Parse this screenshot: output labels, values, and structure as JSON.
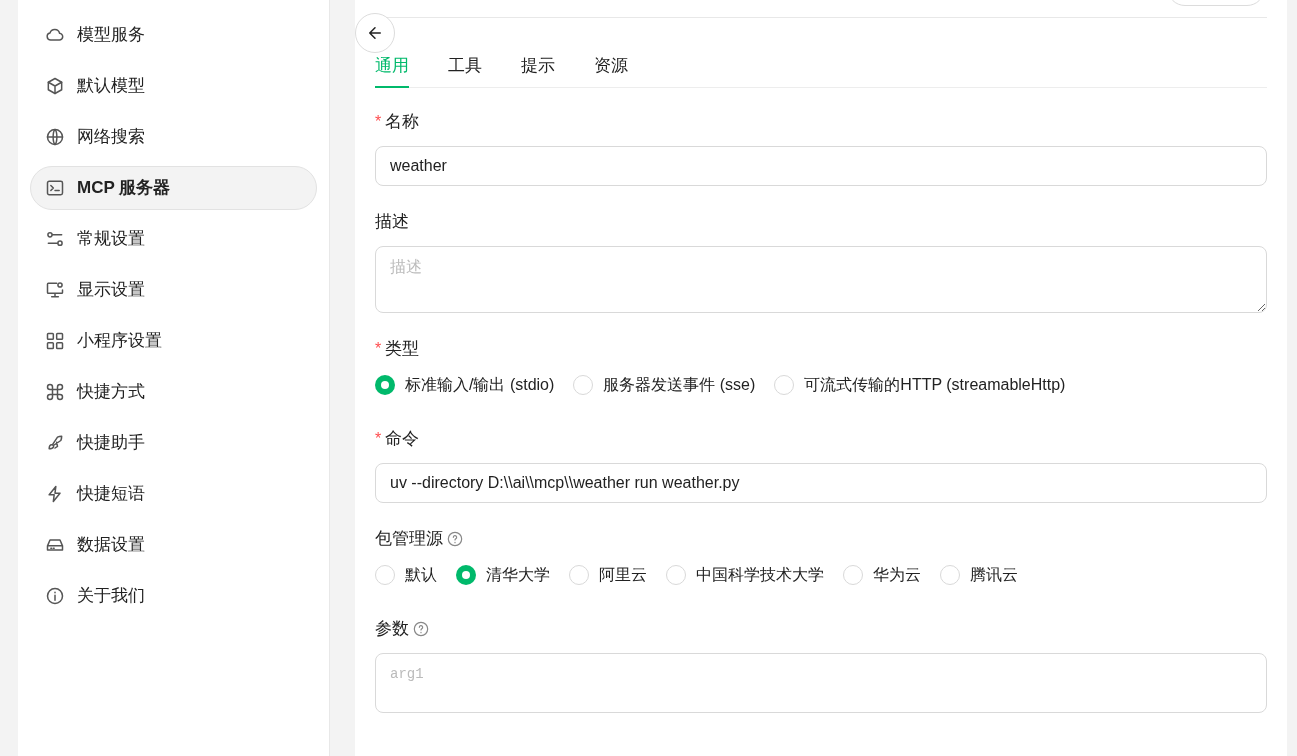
{
  "sidebar": {
    "items": [
      {
        "label": "模型服务",
        "selected": false
      },
      {
        "label": "默认模型",
        "selected": false
      },
      {
        "label": "网络搜索",
        "selected": false
      },
      {
        "label": "MCP 服务器",
        "selected": true
      },
      {
        "label": "常规设置",
        "selected": false
      },
      {
        "label": "显示设置",
        "selected": false
      },
      {
        "label": "小程序设置",
        "selected": false
      },
      {
        "label": "快捷方式",
        "selected": false
      },
      {
        "label": "快捷助手",
        "selected": false
      },
      {
        "label": "快捷短语",
        "selected": false
      },
      {
        "label": "数据设置",
        "selected": false
      },
      {
        "label": "关于我们",
        "selected": false
      }
    ]
  },
  "tabs": [
    {
      "label": "通用",
      "selected": true
    },
    {
      "label": "工具",
      "selected": false
    },
    {
      "label": "提示",
      "selected": false
    },
    {
      "label": "资源",
      "selected": false
    }
  ],
  "form": [
    {
      "kind": "input",
      "required_mark": "*",
      "label": "名称",
      "value": "weather"
    },
    {
      "kind": "textarea",
      "label": "描述",
      "placeholder": "描述"
    },
    {
      "kind": "radio",
      "required_mark": "*",
      "label": "类型",
      "options": [
        {
          "label": "标准输入/输出 (stdio)",
          "selected": true
        },
        {
          "label": "服务器发送事件 (sse)",
          "selected": false
        },
        {
          "label": "可流式传输的HTTP (streamableHttp)",
          "selected": false
        }
      ]
    },
    {
      "kind": "input",
      "required_mark": "*",
      "label": "命令",
      "value": "uv --directory D:\\\\ai\\\\mcp\\\\weather run weather.py"
    },
    {
      "kind": "radio",
      "label": "包管理源",
      "help": true,
      "options": [
        {
          "label": "默认",
          "selected": false
        },
        {
          "label": "清华大学",
          "selected": true
        },
        {
          "label": "阿里云",
          "selected": false
        },
        {
          "label": "中国科学技术大学",
          "selected": false
        },
        {
          "label": "华为云",
          "selected": false
        },
        {
          "label": "腾讯云",
          "selected": false
        }
      ]
    },
    {
      "kind": "code",
      "label": "参数",
      "help": true,
      "placeholder": "arg1"
    }
  ]
}
